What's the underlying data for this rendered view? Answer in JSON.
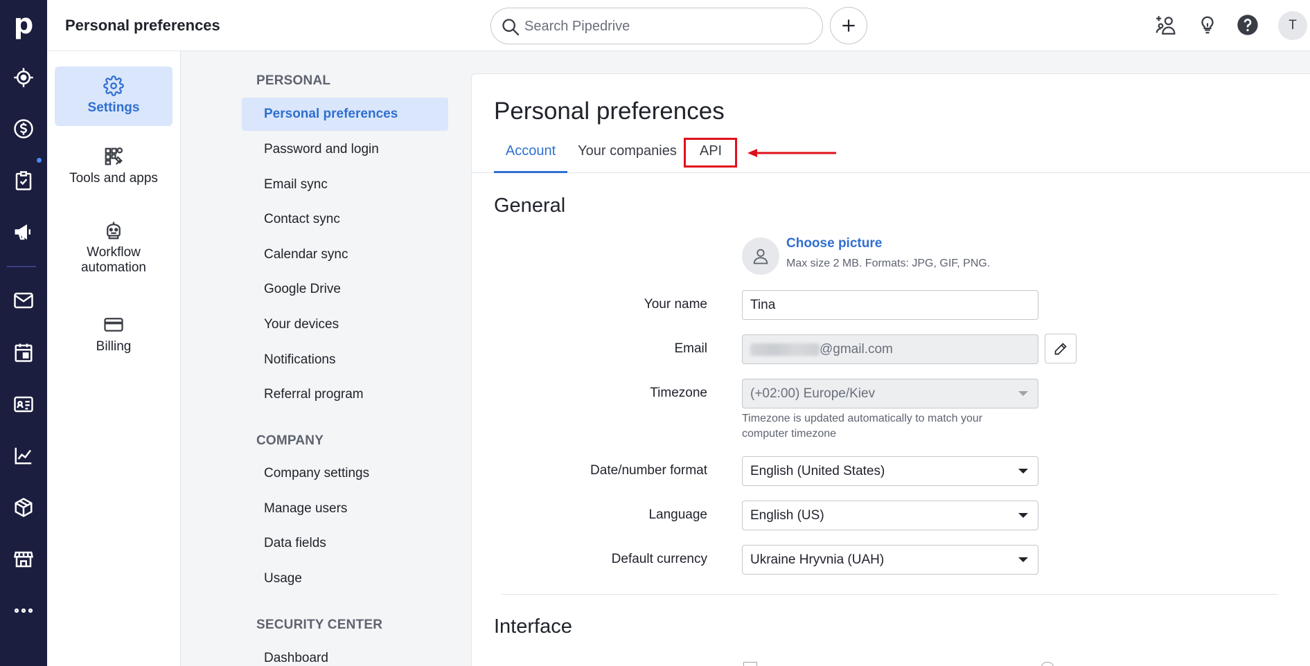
{
  "topbar": {
    "title": "Personal preferences",
    "search_placeholder": "Search Pipedrive",
    "avatar_initial": "T"
  },
  "rail": {
    "logo": "p",
    "icons": [
      "target-icon",
      "dollar-icon",
      "tasks-icon",
      "megaphone-icon",
      "mail-icon",
      "calendar-icon",
      "contacts-icon",
      "chart-icon",
      "box-icon",
      "store-icon",
      "more-icon"
    ]
  },
  "categories": [
    {
      "label": "Settings",
      "icon": "gear-icon"
    },
    {
      "label": "Tools and apps",
      "icon": "tools-icon"
    },
    {
      "label": "Workflow automation",
      "icon": "robot-icon"
    },
    {
      "label": "Billing",
      "icon": "card-icon"
    }
  ],
  "menu": {
    "personal_heading": "PERSONAL",
    "personal_items": [
      "Personal preferences",
      "Password and login",
      "Email sync",
      "Contact sync",
      "Calendar sync",
      "Google Drive",
      "Your devices",
      "Notifications",
      "Referral program"
    ],
    "company_heading": "COMPANY",
    "company_items": [
      "Company settings",
      "Manage users",
      "Data fields",
      "Usage"
    ],
    "security_heading": "SECURITY CENTER",
    "security_items": [
      "Dashboard"
    ]
  },
  "main": {
    "title": "Personal preferences",
    "tabs": [
      {
        "label": "Account",
        "active": true
      },
      {
        "label": "Your companies",
        "active": false
      },
      {
        "label": "API",
        "active": false
      }
    ],
    "general_title": "General",
    "choose_picture": "Choose picture",
    "picture_hint": "Max size 2 MB. Formats: JPG, GIF, PNG.",
    "fields": {
      "name_label": "Your name",
      "name_value": "Tina",
      "email_label": "Email",
      "email_value": "@gmail.com",
      "timezone_label": "Timezone",
      "timezone_value": "(+02:00) Europe/Kiev",
      "timezone_hint": "Timezone is updated automatically to match your computer timezone",
      "date_label": "Date/number format",
      "date_value": "English (United States)",
      "language_label": "Language",
      "language_value": "English (US)",
      "currency_label": "Default currency",
      "currency_value": "Ukraine Hryvnia (UAH)"
    },
    "interface_title": "Interface"
  },
  "colors": {
    "rail": "#1b1e3e",
    "accent": "#2f6fd0",
    "active_bg": "#dae6fb",
    "highlight": "#e0101b"
  }
}
